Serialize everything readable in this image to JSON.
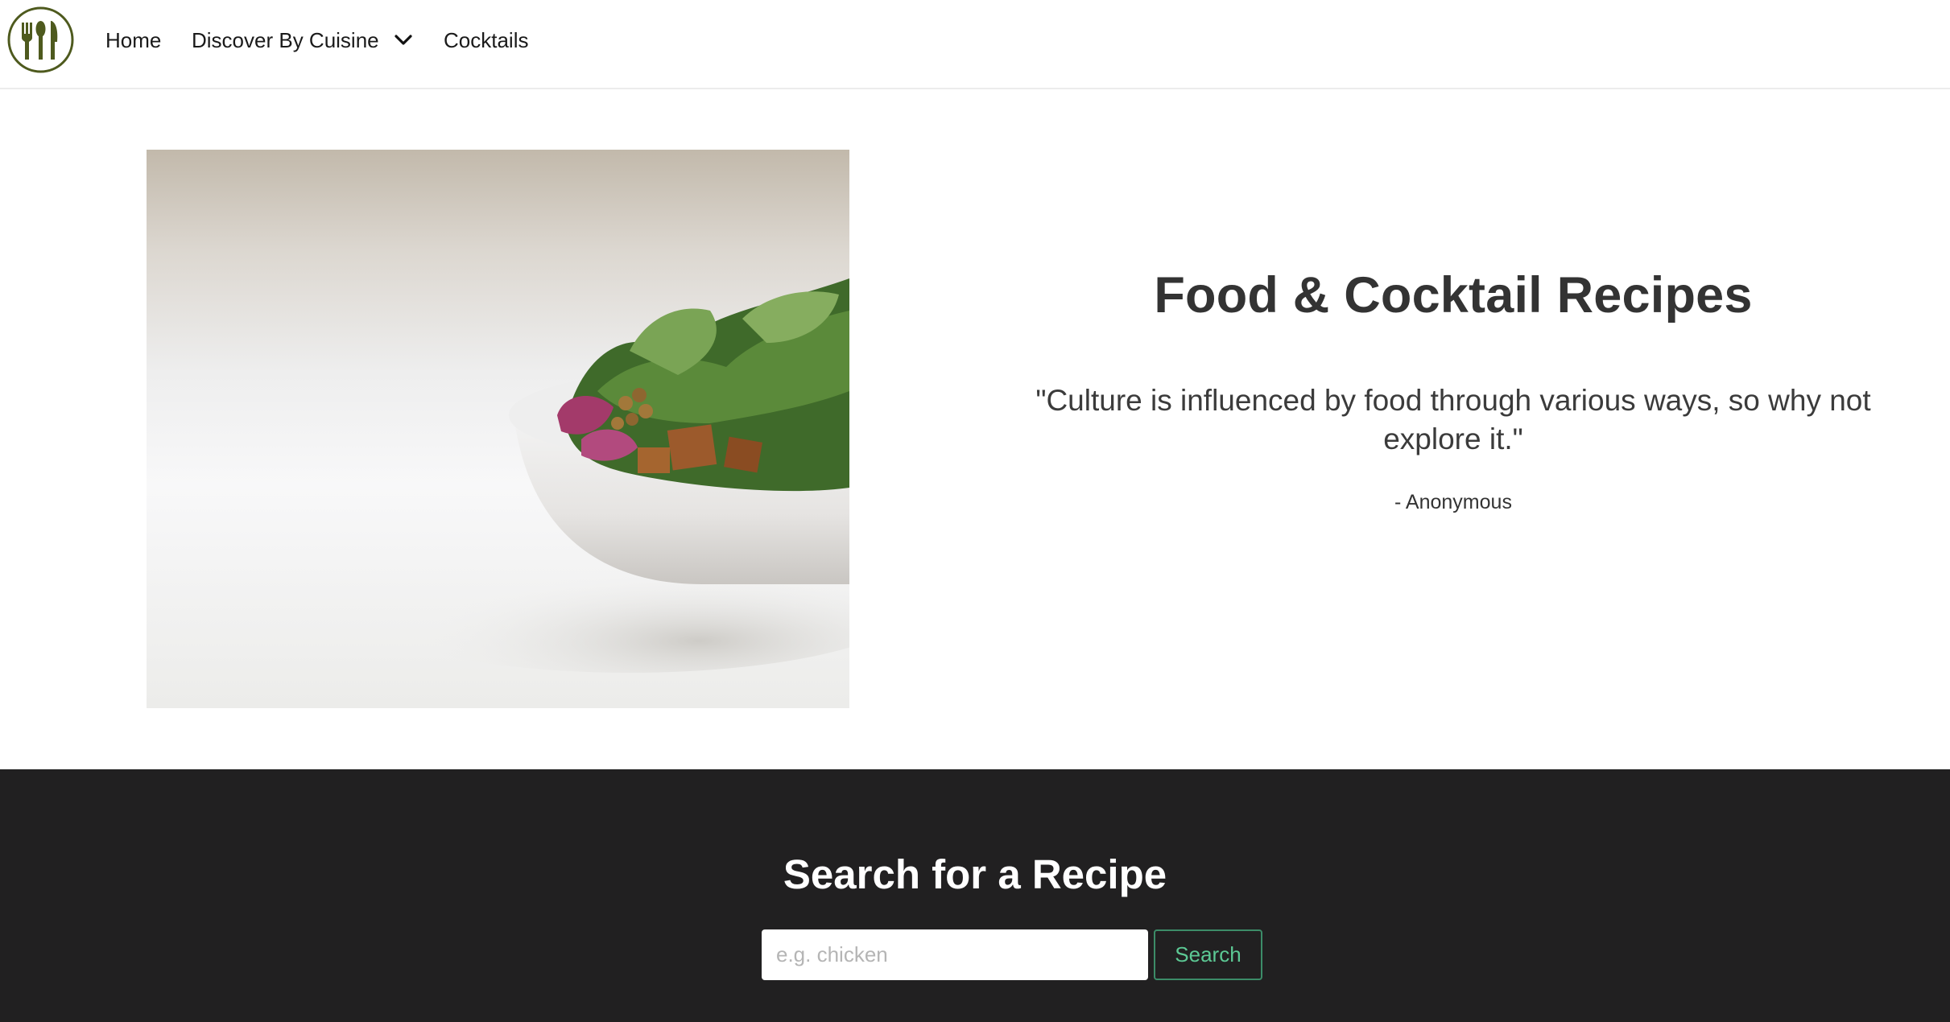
{
  "nav": {
    "logo_icon": "utensils-icon",
    "items": [
      {
        "label": "Home"
      },
      {
        "label": "Discover By Cuisine",
        "icon": "chevron-down-icon"
      },
      {
        "label": "Cocktails"
      }
    ]
  },
  "hero": {
    "image_icon": "salad-bowl-image",
    "title": "Food & Cocktail Recipes",
    "quote": "\"Culture is influenced by food through various ways, so why not explore it.\"",
    "author": "- Anonymous"
  },
  "search": {
    "title": "Search for a Recipe",
    "placeholder": "e.g. chicken",
    "value": "",
    "button_label": "Search"
  },
  "colors": {
    "brand": "#4e5a1e",
    "dark_section": "#212021",
    "accent_green": "#5cc894"
  }
}
